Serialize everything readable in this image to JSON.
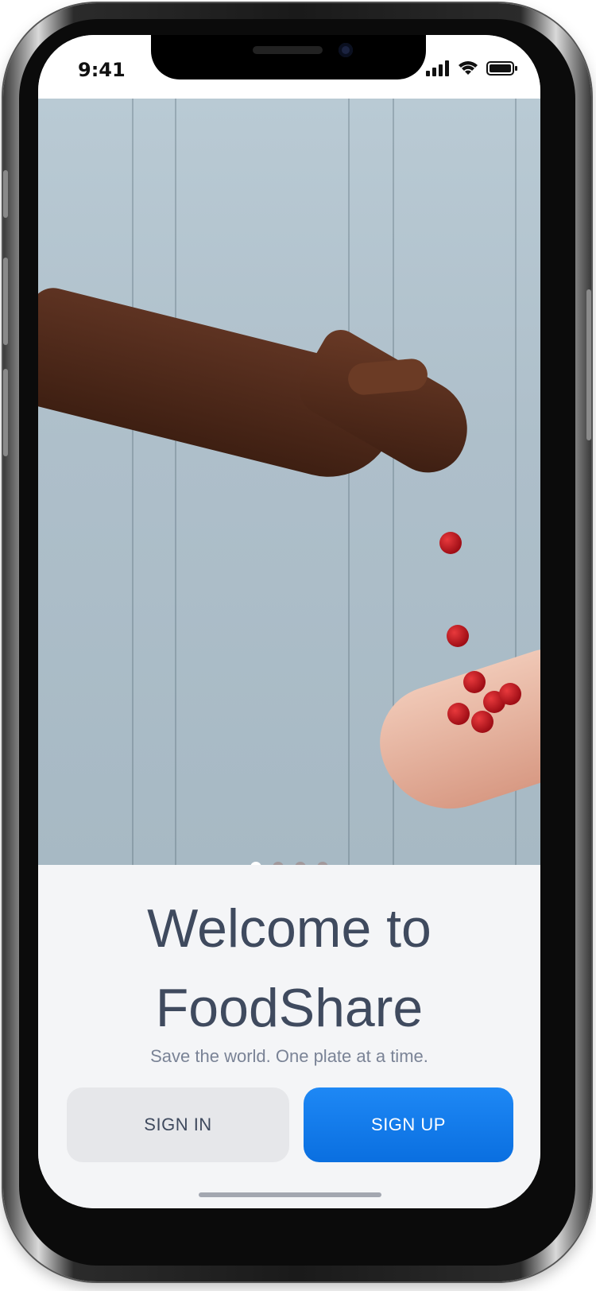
{
  "status_bar": {
    "time": "9:41",
    "icons": [
      "signal-icon",
      "wifi-icon",
      "battery-icon"
    ]
  },
  "carousel": {
    "slide_count": 4,
    "active_index": 0
  },
  "welcome": {
    "title_line1": "Welcome to",
    "title_line2": "FoodShare",
    "subtitle": "Save the world. One plate at a time."
  },
  "actions": {
    "signin_label": "SIGN IN",
    "signup_label": "SIGN UP"
  },
  "colors": {
    "title": "#3f4a5e",
    "subtitle": "#7a8396",
    "signup_bg": "#0a6fe0",
    "signin_bg": "#e6e7ea"
  }
}
